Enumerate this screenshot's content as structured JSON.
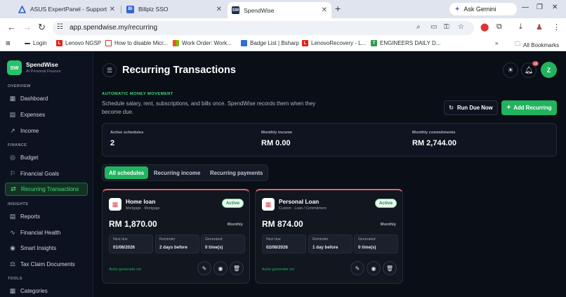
{
  "browser": {
    "tabs": [
      {
        "title": "ASUS ExpertPanel - Support",
        "icon": "asus-logo-icon"
      },
      {
        "title": "Billplz SSO",
        "icon": "billplz-logo-icon",
        "fav_text": "Bi"
      },
      {
        "title": "SpendWise",
        "icon": "spendwise-favicon-icon",
        "fav_text": "SW"
      }
    ],
    "gemini_label": "Ask Gemini",
    "url": "app.spendwise.my/recurring",
    "bookmarks": [
      {
        "label": "Login"
      },
      {
        "label": "Lenovo NGSP",
        "fav_text": "L"
      },
      {
        "label": "How to disable Micr..."
      },
      {
        "label": "Work Order: Work..."
      },
      {
        "label": "Badge List | Bsharp"
      },
      {
        "label": "LenovoRecovery - L...",
        "fav_text": "L"
      },
      {
        "label": "ENGINEERS DAILY D...",
        "fav_text": "T"
      }
    ],
    "all_bookmarks": "All Bookmarks"
  },
  "sidebar": {
    "brand_logo": "SW",
    "brand_name": "SpendWise",
    "brand_sub": "AI Personal Finance",
    "sections": [
      "OVERVIEW",
      "FINANCE",
      "INSIGHTS",
      "TOOLS"
    ],
    "items": [
      {
        "label": "Dashboard",
        "icon": "dashboard-icon"
      },
      {
        "label": "Expenses",
        "icon": "expenses-icon"
      },
      {
        "label": "Income",
        "icon": "income-icon"
      },
      {
        "label": "Budget",
        "icon": "budget-icon"
      },
      {
        "label": "Financial Goals",
        "icon": "goals-icon"
      },
      {
        "label": "Recurring Transactions",
        "icon": "recurring-icon"
      },
      {
        "label": "Reports",
        "icon": "reports-icon"
      },
      {
        "label": "Financial Health",
        "icon": "health-icon"
      },
      {
        "label": "Smart Insights",
        "icon": "insights-icon"
      },
      {
        "label": "Tax Claim Documents",
        "icon": "tax-icon"
      },
      {
        "label": "Categories",
        "icon": "categories-icon"
      }
    ],
    "active_item": "Recurring Transactions"
  },
  "header": {
    "title": "Recurring Transactions",
    "notification_count": "12",
    "avatar_initial": "Z"
  },
  "intro": {
    "kicker": "AUTOMATIC MONEY MOVEMENT",
    "description": "Schedule salary, rent, subscriptions, and bills once. SpendWise records them when they become due.",
    "run_due_label": "Run Due Now",
    "add_label": "Add Recurring"
  },
  "stats": [
    {
      "label": "Active schedules",
      "value": "2"
    },
    {
      "label": "Monthly income",
      "value": "RM 0.00"
    },
    {
      "label": "Monthly commitments",
      "value": "RM 2,744.00"
    }
  ],
  "filter_tabs": [
    {
      "label": "All schedules",
      "active": true
    },
    {
      "label": "Recurring income",
      "active": false
    },
    {
      "label": "Recurring payments",
      "active": false
    }
  ],
  "cards": [
    {
      "title": "Home loan",
      "subtitle": "Mortgage · Mortgage",
      "status": "Active",
      "amount": "RM 1,870.00",
      "frequency": "Monthly",
      "next_due_label": "Next due",
      "next_due": "01/08/2026",
      "reminder_label": "Reminder",
      "reminder": "2 days before",
      "generated_label": "Generated",
      "generated": "0 time(s)",
      "auto_label": "Auto generate on"
    },
    {
      "title": "Personal Loan",
      "subtitle": "Custom · Loan / Commitment",
      "status": "Active",
      "amount": "RM 874.00",
      "frequency": "Monthly",
      "next_due_label": "Next due",
      "next_due": "02/08/2026",
      "reminder_label": "Reminder",
      "reminder": "1 day before",
      "generated_label": "Generated",
      "generated": "0 time(s)",
      "auto_label": "Auto generate on"
    }
  ],
  "colors": {
    "accent": "#22b35f",
    "accent_text": "#3ddc84",
    "card_top_border": "#d9646e",
    "background": "#0a0e16"
  }
}
